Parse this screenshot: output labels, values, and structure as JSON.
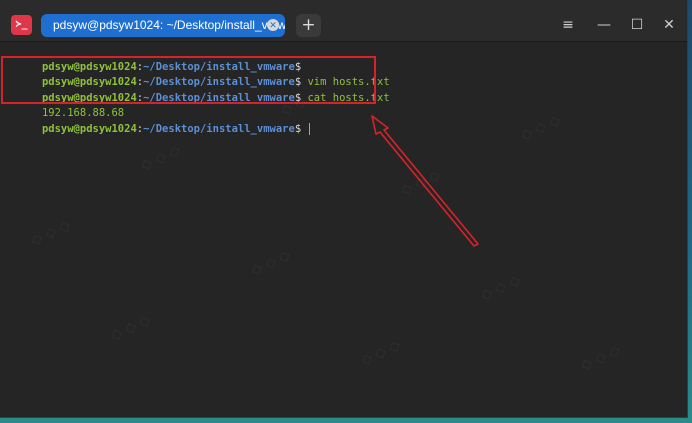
{
  "titlebar": {
    "app_icon_glyph": "≻_",
    "tab_title": "pdsyw@pdsyw1024: ~/Desktop/install_vmware",
    "tab_close_glyph": "✕",
    "add_tab_glyph": "+",
    "menu_glyph": "≡",
    "minimize_glyph": "—",
    "maximize_glyph": "☐",
    "close_glyph": "✕"
  },
  "terminal": {
    "lines": [
      {
        "user": "pdsyw@pdsyw1024",
        "colon": ":",
        "path": "~/Desktop/install_vmware",
        "dollar": "$",
        "command": ""
      },
      {
        "user": "pdsyw@pdsyw1024",
        "colon": ":",
        "path": "~/Desktop/install_vmware",
        "dollar": "$",
        "command": " vim hosts.txt"
      },
      {
        "user": "pdsyw@pdsyw1024",
        "colon": ":",
        "path": "~/Desktop/install_vmware",
        "dollar": "$",
        "command": " cat hosts.txt"
      },
      {
        "output": "192.168.88.68"
      },
      {
        "user": "pdsyw@pdsyw1024",
        "colon": ":",
        "path": "~/Desktop/install_vmware",
        "dollar": "$",
        "command": " "
      }
    ]
  },
  "colors": {
    "prompt_user": "#8ec13d",
    "prompt_path": "#5b8fd6",
    "annotation_red": "#d6232a",
    "tab_active": "#1f6fd1"
  }
}
